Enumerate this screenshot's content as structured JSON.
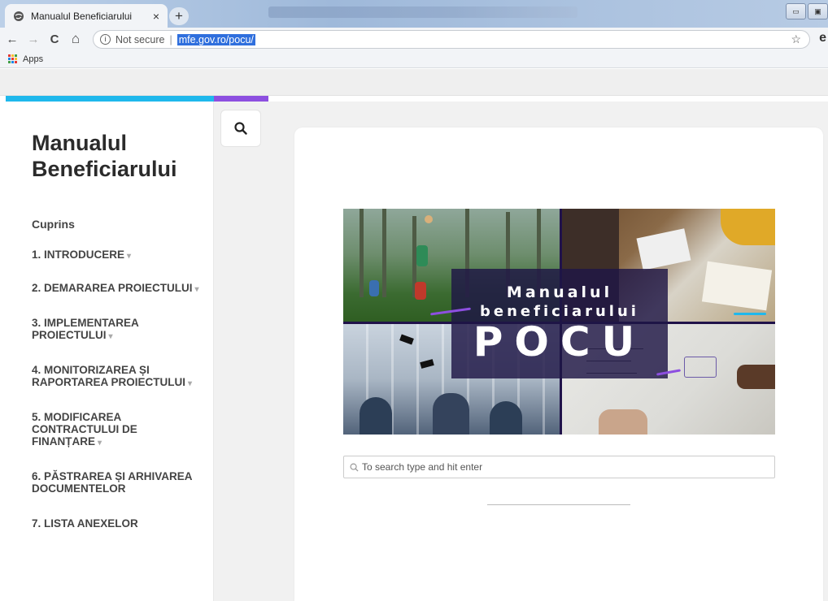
{
  "browser": {
    "tab_title": "Manualul Beneficiarului",
    "tab_close": "×",
    "new_tab": "+",
    "security_label": "Not secure",
    "url": "mfe.gov.ro/pocu/",
    "bookmarks_apps": "Apps",
    "window_buttons": [
      "▭",
      "▣"
    ]
  },
  "nav": {
    "back": "←",
    "forward": "→",
    "reload": "C",
    "home": "⌂"
  },
  "sidebar": {
    "title": "Manualul Beneficiarului",
    "toc_heading": "Cuprins",
    "items": [
      {
        "label": "1. INTRODUCERE",
        "caret": "▾"
      },
      {
        "label": "2. DEMARAREA PROIECTULUI",
        "caret": "▾"
      },
      {
        "label": "3. IMPLEMENTAREA PROIECTULUI",
        "caret": "▾"
      },
      {
        "label": "4. MONITORIZAREA ȘI RAPORTAREA PROIECTULUI",
        "caret": "▾"
      },
      {
        "label": "5. MODIFICAREA CONTRACTULUI DE FINANȚARE",
        "caret": "▾"
      },
      {
        "label": "6. PĂSTRAREA ȘI ARHIVAREA DOCUMENTELOR",
        "caret": ""
      },
      {
        "label": "7. LISTA ANEXELOR",
        "caret": ""
      }
    ]
  },
  "hero": {
    "line1": "Manualul",
    "line2": "beneficiarului",
    "line3": "POCU"
  },
  "search": {
    "placeholder": "To search type and hit enter"
  },
  "colors": {
    "accent_cyan": "#1fb8ec",
    "accent_purple": "#8d4fe0",
    "hero_overlay": "#1e1646"
  }
}
